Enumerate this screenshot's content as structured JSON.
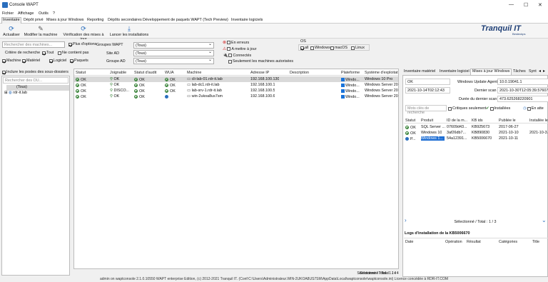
{
  "window": {
    "title": "Console WAPT"
  },
  "menu": [
    "Fichier",
    "Affichage",
    "Outils",
    "?"
  ],
  "tabs": [
    "Inventaire",
    "Dépôt privé",
    "Mises à jour Windows",
    "Reporting",
    "Dépôts secondaires",
    "Développement de paquets WAPT (Tech Preview)",
    "Inventaire logiciels"
  ],
  "toolbar": {
    "refresh": "Actualiser",
    "edit": "Modifier la machine",
    "check_updates": "Vérification des mises à jour",
    "install": "Lancer les installations"
  },
  "logo": {
    "name": "Tranquil IT",
    "sub": "Besteckps"
  },
  "filters": {
    "search_placeholder": "Rechercher des machines...",
    "more_options": "Plus d'options",
    "criteria_label": "Critère de recherche",
    "all": "Tout",
    "not_contains": "Ne contient pas",
    "machine": "Machine",
    "material": "Matériel",
    "software": "Logiciel",
    "packages": "Paquets",
    "groups_wapt_label": "Groupes WAPT",
    "groups_wapt_value": "(Tous)",
    "site_ad_label": "Site AD",
    "site_ad_value": "(Tous)",
    "group_ad_label": "Groupe AD",
    "group_ad_value": "(Tous)",
    "status_error": "En erreurs",
    "status_update": "A mettre à jour",
    "status_connected": "Connectés",
    "only_allowed": "Seulement les machines autorisées",
    "os_label": "OS",
    "os_all": "all",
    "os_windows": "Windows",
    "os_macos": "macOS",
    "os_linux": "Linux"
  },
  "left": {
    "include_sub": "Inclure les postes des sous-dossiers",
    "ou_placeholder": "Rechercher des OU...",
    "tree_root": "(Tous)",
    "tree_child": "rdr-it.lab"
  },
  "hosts": {
    "headers": [
      "Statut",
      "Joignable",
      "Statut d'audit",
      "WUA",
      "Machine",
      "Adresse IP",
      "Description",
      "Plateforme",
      "Système d'exploitat"
    ],
    "rows": [
      {
        "status": "OK",
        "reach": "OK",
        "audit": "OK",
        "wua": "OK",
        "machine": "cli-lab-01.rdr-it.lab",
        "ip": "192.168.100.130",
        "desc": "",
        "platform": "Windo...",
        "os": "Windows 10 Pro"
      },
      {
        "status": "OK",
        "reach": "OK",
        "audit": "OK",
        "wua": "OK",
        "machine": "lab-dc1.rdr-it.lab",
        "ip": "192.168.100.1",
        "desc": "",
        "platform": "Windo...",
        "os": "Windows Server 20"
      },
      {
        "status": "OK",
        "reach": "DISCO...",
        "audit": "OK",
        "wua": "OK",
        "machine": "lab-srv-1.rdr-it.lab",
        "ip": "192.168.100.5",
        "desc": "",
        "platform": "Windo...",
        "os": "Windows Server 20"
      },
      {
        "status": "OK",
        "reach": "OK",
        "audit": "OK",
        "wua": "",
        "machine": "win-2ukoa8us7sm",
        "ip": "192.168.100.6",
        "desc": "",
        "platform": "Windo...",
        "os": "Windows Server 20"
      }
    ],
    "footer": "Sélectionné / Total : 1 / 4"
  },
  "right": {
    "tabs": [
      "Inventaire matériel",
      "Inventaire logiciel",
      "Mises à jour Windows",
      "Tâches",
      "Synt"
    ],
    "status_value": "OK",
    "agent_label": "Windows Update Agent",
    "agent_value": "10.0.19041.1",
    "date_value": "2021-10-14T02:12:43",
    "last_scan_label": "Dernier scan",
    "last_scan_value": "2021-10-30T12:05:39.57607",
    "duration_label": "Durée du dernier scan",
    "duration_value": "473.625268220901",
    "kb_search_placeholder": "Mots clés de recherche",
    "critical_only": "Critiques seulement",
    "installed": "Installées",
    "pending": "En atte",
    "updates_headers": [
      "Statut",
      "Produit",
      "ID de la m...",
      "KB ids",
      "Publiée le",
      "Installée le"
    ],
    "updates": [
      {
        "status": "OK",
        "product": "SQL Server ...",
        "id": "07609d43...",
        "kb": "KB925673",
        "published": "2017-06-27",
        "installed": ""
      },
      {
        "status": "OK",
        "product": "Windows 10",
        "id": "3af26db7...",
        "kb": "KB890830",
        "published": "2021-10-10",
        "installed": "2021-10-3..."
      },
      {
        "status": "P...",
        "product": "Windows 1...",
        "id": "54a12391...",
        "kb": "KB5006670",
        "published": "2021-10-11",
        "installed": ""
      }
    ],
    "updates_footer": "Sélectionné / Total : 1 / 3",
    "logs_title": "Logs d'installation de la KB5006670",
    "logs_headers": [
      "Date",
      "Opération",
      "Résultat",
      "Catégories",
      "Title"
    ]
  },
  "statusbar": "admin on waptconsole 2.1.0.10550 WAPT enterprise Edition, (c) 2012-2021 Tranquil IT. (Conf:C:\\Users\\Administrateur.WIN-2UKOA8US7SM\\AppData\\Local\\waptconsole\\waptconsole.ini) Licence concédée à RDR-IT.COM"
}
